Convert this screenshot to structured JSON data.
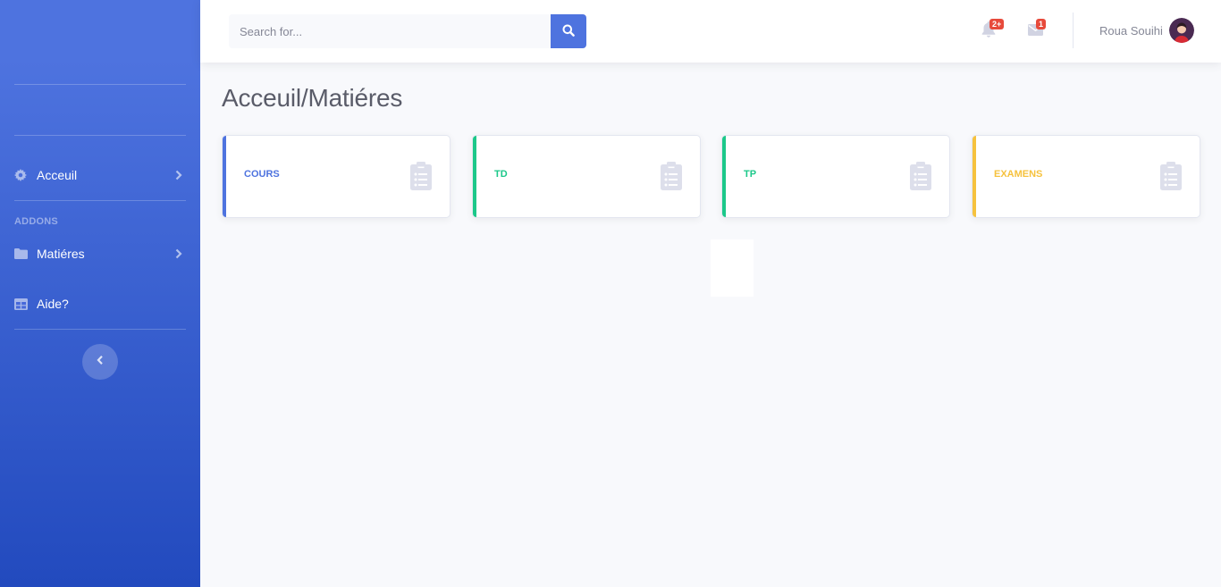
{
  "sidebar": {
    "nav": [
      {
        "label": "Acceuil",
        "icon": "gear-icon"
      },
      {
        "label": "Matiéres",
        "icon": "folder-icon"
      },
      {
        "label": "Aide?",
        "icon": "table-icon"
      }
    ],
    "heading": "ADDONS",
    "toggle_icon": "chevron-left-icon"
  },
  "topbar": {
    "search": {
      "placeholder": "Search for..."
    },
    "alerts_badge": "2+",
    "messages_badge": "1",
    "user_name": "Roua Souihi"
  },
  "main": {
    "title": "Acceuil/Matiéres",
    "cards": [
      {
        "label": "COURS",
        "color": "#4e73df",
        "icon": "clipboard-list-icon"
      },
      {
        "label": "TD",
        "color": "#1cc88a",
        "icon": "clipboard-list-icon"
      },
      {
        "label": "TP",
        "color": "#1cc88a",
        "icon": "clipboard-list-icon"
      },
      {
        "label": "EXAMENS",
        "color": "#f6c23e",
        "icon": "clipboard-list-icon"
      }
    ]
  },
  "colors": {
    "primary": "#4e73df",
    "success": "#1cc88a",
    "warning": "#f6c23e",
    "danger": "#e74a3b"
  }
}
